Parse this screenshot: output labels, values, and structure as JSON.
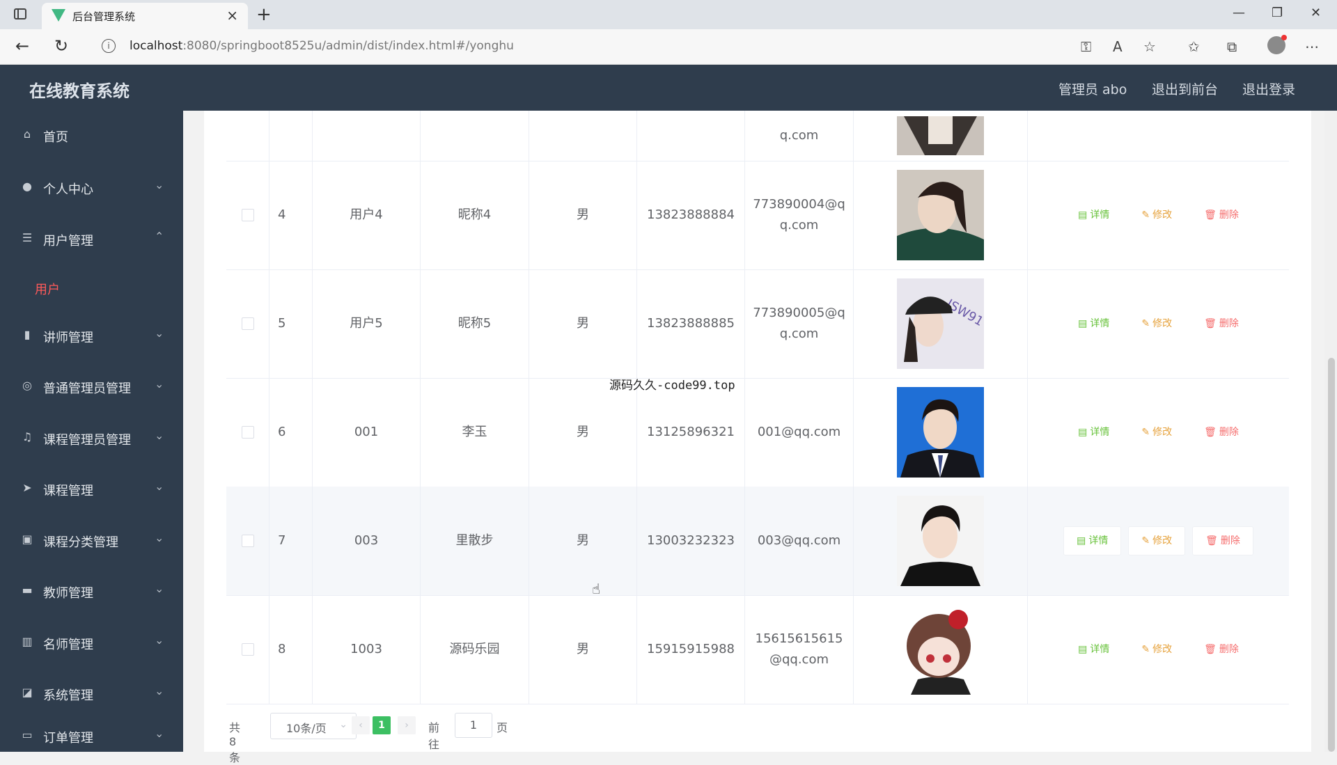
{
  "browser": {
    "tab_title": "后台管理系统",
    "url_host": "localhost",
    "url_rest": ":8080/springboot8525u/admin/dist/index.html#/yonghu"
  },
  "header": {
    "title": "在线教育系统",
    "admin_label": "管理员 abo",
    "to_front": "退出到前台",
    "logout": "退出登录"
  },
  "sidebar": {
    "items": [
      {
        "label": "首页",
        "icon": "home-icon"
      },
      {
        "label": "个人中心",
        "icon": "user-icon"
      },
      {
        "label": "用户管理",
        "icon": "list-icon"
      },
      {
        "label": "讲师管理",
        "icon": "book-icon"
      },
      {
        "label": "普通管理员管理",
        "icon": "compass-icon"
      },
      {
        "label": "课程管理员管理",
        "icon": "bell-icon"
      },
      {
        "label": "课程管理",
        "icon": "send-icon"
      },
      {
        "label": "课程分类管理",
        "icon": "clipboard-icon"
      },
      {
        "label": "教师管理",
        "icon": "chat-icon"
      },
      {
        "label": "名师管理",
        "icon": "bar-chart-icon"
      },
      {
        "label": "系统管理",
        "icon": "line-chart-icon"
      },
      {
        "label": "订单管理",
        "icon": "order-icon"
      }
    ],
    "sub_active": "用户"
  },
  "table": {
    "partial_top_text": "q.com",
    "rows": [
      {
        "id": "4",
        "account": "用户4",
        "nick": "昵称4",
        "gender": "男",
        "phone": "13823888884",
        "email": "773890004@q\nq.com"
      },
      {
        "id": "5",
        "account": "用户5",
        "nick": "昵称5",
        "gender": "男",
        "phone": "13823888885",
        "email": "773890005@q\nq.com"
      },
      {
        "id": "6",
        "account": "001",
        "nick": "李玉",
        "gender": "男",
        "phone": "13125896321",
        "email": "001@qq.com"
      },
      {
        "id": "7",
        "account": "003",
        "nick": "里散步",
        "gender": "男",
        "phone": "13003232323",
        "email": "003@qq.com"
      },
      {
        "id": "8",
        "account": "1003",
        "nick": "源码乐园",
        "gender": "男",
        "phone": "15915915988",
        "email": "15615615615\n@qq.com"
      }
    ],
    "actions": {
      "detail": "详情",
      "edit": "修改",
      "delete": "删除"
    }
  },
  "pager": {
    "total": "共 8 条",
    "size": "10条/页",
    "current": "1",
    "goto_prefix": "前往",
    "goto_value": "1",
    "goto_suffix": "页"
  },
  "overlay": "源码久久-code99.top",
  "colors": {
    "sidebar_bg": "#2f3d4d",
    "active_sub": "#ff5a5a",
    "detail": "#67c23a",
    "edit": "#e6a23c",
    "delete": "#f56c6c",
    "pager_active": "#3cbf62"
  }
}
